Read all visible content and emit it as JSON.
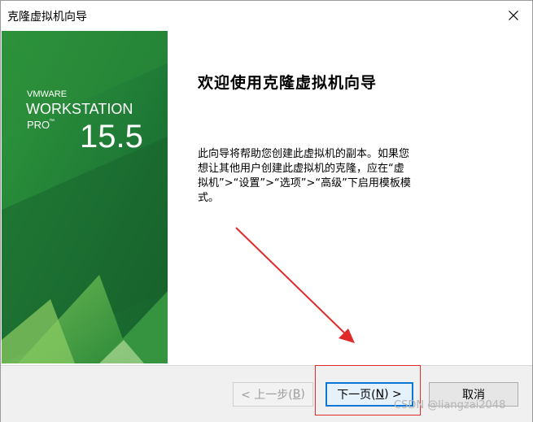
{
  "window": {
    "title": "克隆虚拟机向导"
  },
  "banner": {
    "brand_vm": "VMWARE",
    "brand_product": "WORKSTATION",
    "brand_edition": "PRO",
    "brand_tm": "™",
    "version": "15.5"
  },
  "content": {
    "heading": "欢迎使用克隆虚拟机向导",
    "description": "此向导将帮助您创建此虚拟机的副本。如果您想让其他用户创建此虚拟机的克隆，应在“虚拟机”>“设置”>“选项”>“高级”下启用模板模式。"
  },
  "buttons": {
    "back": {
      "prefix": "< 上一步(",
      "key": "B",
      "suffix": ")"
    },
    "next": {
      "prefix": "下一页(",
      "key": "N",
      "suffix": ") >"
    },
    "cancel": "取消"
  },
  "watermark": "CSDN @liangzai2048",
  "colors": {
    "banner_dark": "#1c6e34",
    "banner_light": "#3aaa35",
    "annotation_red": "#e02b2b",
    "default_button_border": "#0b78d7"
  }
}
